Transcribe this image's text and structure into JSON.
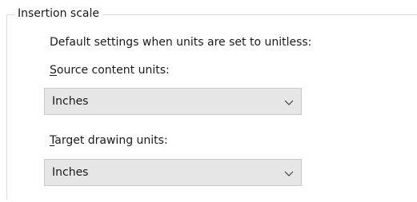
{
  "group": {
    "title": "Insertion scale"
  },
  "defaults_text": "Default settings when units are set to unitless:",
  "source": {
    "label_mnemonic": "S",
    "label_rest": "ource content units:",
    "value": "Inches",
    "icon": "chevron-down-icon"
  },
  "target": {
    "label_mnemonic": "T",
    "label_rest": "arget drawing units:",
    "value": "Inches",
    "icon": "chevron-down-icon"
  },
  "colors": {
    "dropdown_bg": "#e6e6e6",
    "dropdown_border": "#c9c9c9",
    "group_border": "#d9d9d9"
  }
}
